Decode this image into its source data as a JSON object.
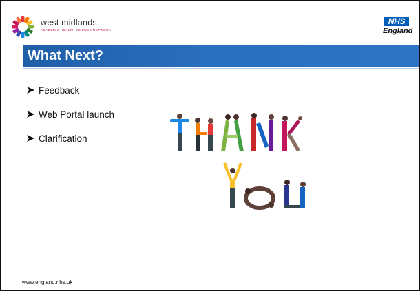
{
  "header": {
    "org_name": "west midlands",
    "org_subtitle": "ACADEMIC HEALTH SCIENCE NETWORK",
    "nhs_mark": "NHS",
    "nhs_region": "England"
  },
  "title": "What Next?",
  "bullets": [
    {
      "text": "Feedback"
    },
    {
      "text": "Web Portal launch"
    },
    {
      "text": "Clarification"
    }
  ],
  "image": {
    "word_1": "THANK",
    "word_2": "YOU"
  },
  "footer": {
    "url": "www.england.nhs.uk"
  },
  "colors": {
    "title_band": "#2a6fbd",
    "nhs_blue": "#005eb8",
    "text": "#111111"
  }
}
